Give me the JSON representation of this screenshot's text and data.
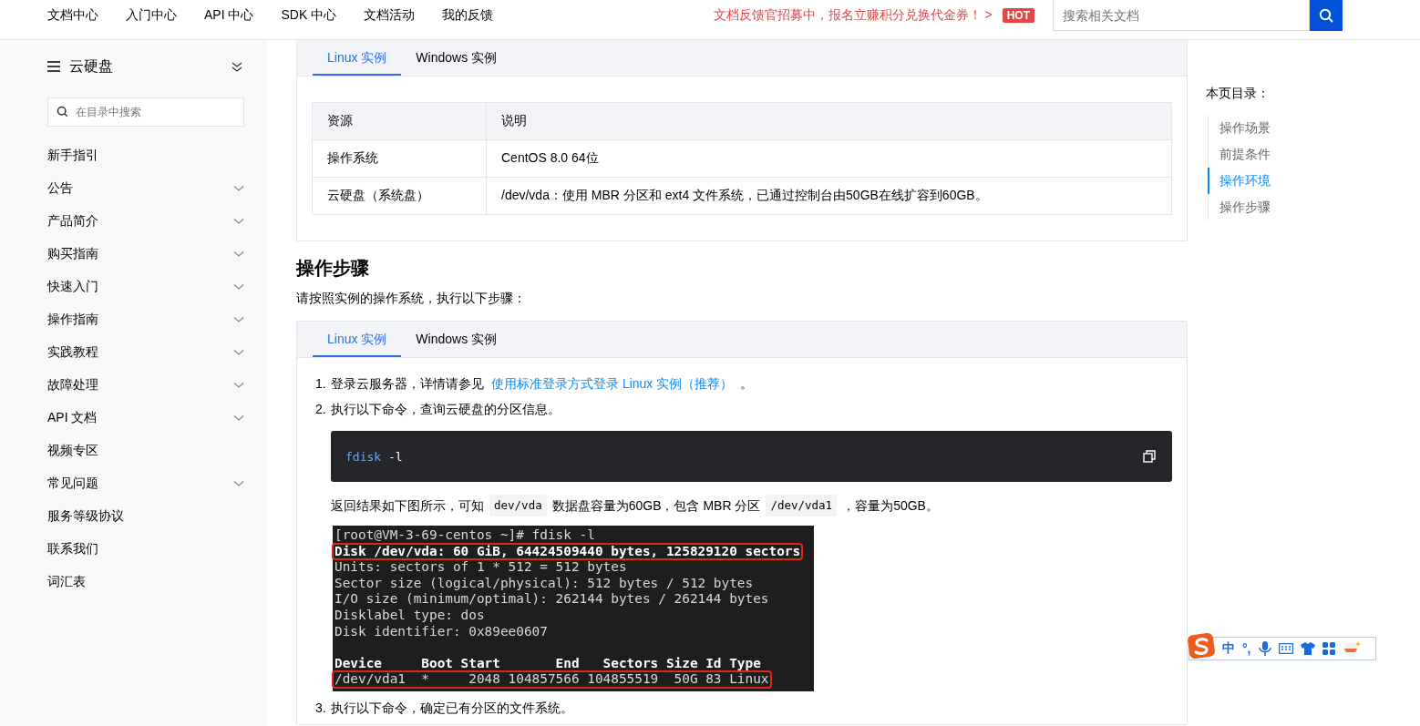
{
  "top_nav": {
    "links": [
      "文档中心",
      "入门中心",
      "API 中心",
      "SDK 中心",
      "文档活动",
      "我的反馈"
    ],
    "promo": "文档反馈官招募中，报名立赚积分兑换代金券！ >",
    "badge": "HOT",
    "search": {
      "placeholder": "搜索相关文档"
    }
  },
  "sidebar": {
    "title": "云硬盘",
    "search": {
      "placeholder": "在目录中搜索"
    },
    "items": [
      {
        "label": "新手指引",
        "expandable": false
      },
      {
        "label": "公告",
        "expandable": true
      },
      {
        "label": "产品简介",
        "expandable": true
      },
      {
        "label": "购买指南",
        "expandable": true
      },
      {
        "label": "快速入门",
        "expandable": true
      },
      {
        "label": "操作指南",
        "expandable": true
      },
      {
        "label": "实践教程",
        "expandable": true
      },
      {
        "label": "故障处理",
        "expandable": true
      },
      {
        "label": "API 文档",
        "expandable": true
      },
      {
        "label": "视频专区",
        "expandable": false
      },
      {
        "label": "常见问题",
        "expandable": true
      },
      {
        "label": "服务等级协议",
        "expandable": false
      },
      {
        "label": "联系我们",
        "expandable": false
      },
      {
        "label": "词汇表",
        "expandable": false
      }
    ]
  },
  "env_panel": {
    "tabs": [
      {
        "label": "Linux 实例",
        "selected": true
      },
      {
        "label": "Windows 实例",
        "selected": false
      }
    ],
    "table": {
      "columns": [
        "资源",
        "说明"
      ],
      "rows": [
        [
          "操作系统",
          "CentOS 8.0 64位"
        ],
        [
          "云硬盘（系统盘）",
          "/dev/vda：使用 MBR 分区和 ext4 文件系统，已通过控制台由50GB在线扩容到60GB。"
        ]
      ]
    }
  },
  "section": {
    "heading": "操作步骤",
    "intro": "请按照实例的操作系统，执行以下步骤："
  },
  "steps_panel": {
    "tabs": [
      {
        "label": "Linux 实例",
        "selected": true
      },
      {
        "label": "Windows 实例",
        "selected": false
      }
    ],
    "steps": [
      {
        "number": "1.",
        "text": "登录云服务器，详情请参见",
        "link": "使用标准登录方式登录 Linux 实例（推荐）",
        "after": "。"
      },
      {
        "number": "2.",
        "text": "执行以下命令，查询云硬盘的分区信息。",
        "code": {
          "command": "fdisk",
          "args": "-l"
        },
        "result": [
          {
            "kind": "text",
            "text": "返回结果如下图所示，可知"
          },
          {
            "kind": "code",
            "text": "dev/vda"
          },
          {
            "kind": "text",
            "text": "数据盘容量为60GB，包含 MBR 分区"
          },
          {
            "kind": "code",
            "text": "/dev/vda1"
          },
          {
            "kind": "text",
            "text": "，容量为50GB。"
          }
        ],
        "terminal": [
          {
            "text": "[root@VM-3-69-centos ~]# fdisk -l",
            "bold": false,
            "highlighted": false,
            "gap_before": false
          },
          {
            "text": "Disk /dev/vda: 60 GiB, 64424509440 bytes, 125829120 sectors",
            "bold": true,
            "highlighted": true,
            "gap_before": false
          },
          {
            "text": "Units: sectors of 1 * 512 = 512 bytes",
            "bold": false,
            "highlighted": false,
            "gap_before": false
          },
          {
            "text": "Sector size (logical/physical): 512 bytes / 512 bytes",
            "bold": false,
            "highlighted": false,
            "gap_before": false
          },
          {
            "text": "I/O size (minimum/optimal): 262144 bytes / 262144 bytes",
            "bold": false,
            "highlighted": false,
            "gap_before": false
          },
          {
            "text": "Disklabel type: dos",
            "bold": false,
            "highlighted": false,
            "gap_before": false
          },
          {
            "text": "Disk identifier: 0x89ee0607",
            "bold": false,
            "highlighted": false,
            "gap_before": false
          },
          {
            "text": "Device     Boot Start       End   Sectors Size Id Type",
            "bold": true,
            "highlighted": false,
            "gap_before": true
          },
          {
            "text": "/dev/vda1  *     2048 104857566 104855519  50G 83 Linux",
            "bold": false,
            "highlighted": true,
            "gap_before": false
          }
        ]
      },
      {
        "number": "3.",
        "text": "执行以下命令，确定已有分区的文件系统。"
      }
    ]
  },
  "toc": {
    "title": "本页目录：",
    "items": [
      {
        "label": "操作场景",
        "selected": false
      },
      {
        "label": "前提条件",
        "selected": false
      },
      {
        "label": "操作环境",
        "selected": true
      },
      {
        "label": "操作步骤",
        "selected": false
      }
    ]
  },
  "ime_toolbar": {
    "mode": "中",
    "punctuation": "°,"
  }
}
